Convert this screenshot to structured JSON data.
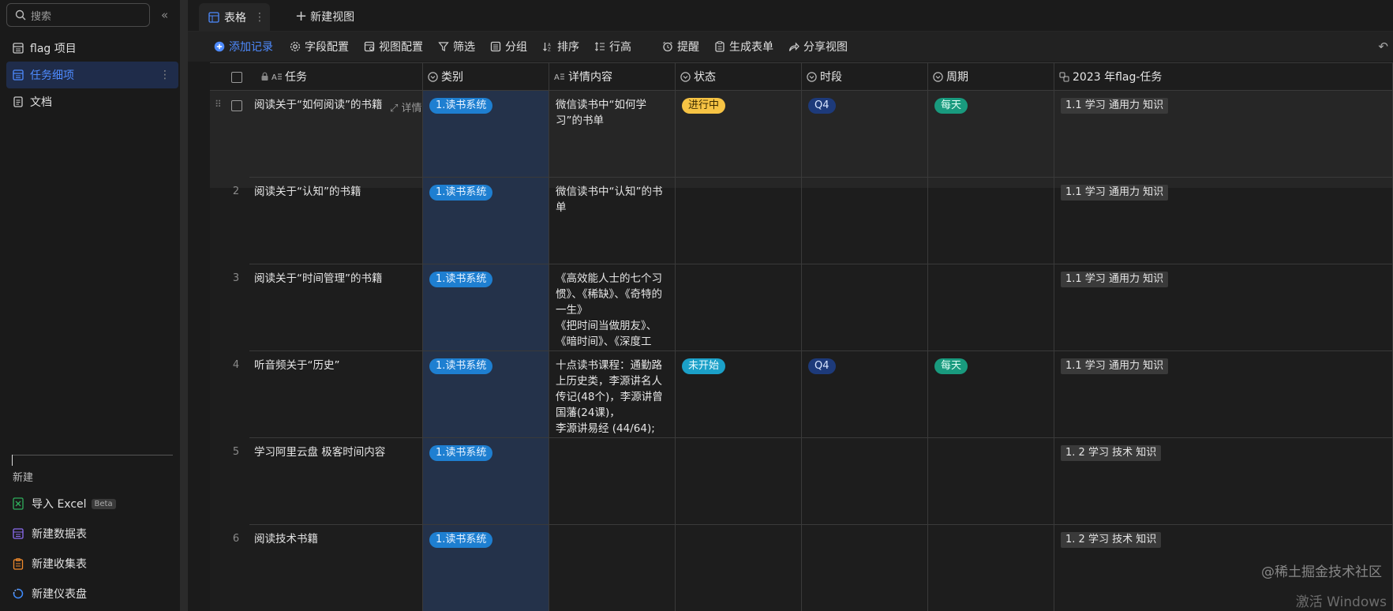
{
  "sidebar": {
    "search_placeholder": "搜索",
    "items": [
      {
        "label": "flag 项目"
      },
      {
        "label": "任务细项"
      },
      {
        "label": "文档"
      }
    ],
    "new_label": "新建",
    "create_items": [
      {
        "label": "导入 Excel",
        "badge": "Beta"
      },
      {
        "label": "新建数据表"
      },
      {
        "label": "新建收集表"
      },
      {
        "label": "新建仪表盘"
      }
    ]
  },
  "tabs": {
    "active": "表格",
    "new_view": "新建视图"
  },
  "toolbar": {
    "add": "添加记录",
    "field_config": "字段配置",
    "view_config": "视图配置",
    "filter": "筛选",
    "group": "分组",
    "sort": "排序",
    "row_height": "行高",
    "remind": "提醒",
    "form": "生成表单",
    "share": "分享视图"
  },
  "table": {
    "columns": [
      "任务",
      "类别",
      "详情内容",
      "状态",
      "时段",
      "周期",
      "2023 年flag-任务"
    ],
    "detail_link": "详情",
    "rows": [
      {
        "num": "",
        "task": "阅读关于“如何阅读”的书籍",
        "category": "1.读书系统",
        "detail": "微信读书中“如何学习”的书单",
        "status": "进行中",
        "period": "Q4",
        "cycle": "每天",
        "flag": "1.1 学习 通用力 知识"
      },
      {
        "num": "2",
        "task": "阅读关于“认知”的书籍",
        "category": "1.读书系统",
        "detail": "微信读书中“认知”的书单",
        "status": "",
        "period": "",
        "cycle": "",
        "flag": "1.1 学习 通用力 知识"
      },
      {
        "num": "3",
        "task": "阅读关于“时间管理”的书籍",
        "category": "1.读书系统",
        "detail": "《高效能人士的七个习惯》、《稀缺》、《奇特的一生》\n《把时间当做朋友》、《暗时间》、《深度工作》、《每天最重要的两小...",
        "status": "",
        "period": "",
        "cycle": "",
        "flag": "1.1 学习 通用力 知识"
      },
      {
        "num": "4",
        "task": "听音频关于“历史”",
        "category": "1.读书系统",
        "detail": "十点读书课程：通勤路上历史类，李源讲名人传记(48个)，李源讲曾国藩(24课)，\n李源讲易经 (44/64);",
        "status": "未开始",
        "period": "Q4",
        "cycle": "每天",
        "flag": "1.1 学习 通用力 知识"
      },
      {
        "num": "5",
        "task": "学习阿里云盘 极客时间内容",
        "category": "1.读书系统",
        "detail": "",
        "status": "",
        "period": "",
        "cycle": "",
        "flag": "1. 2 学习 技术 知识"
      },
      {
        "num": "6",
        "task": "阅读技术书籍",
        "category": "1.读书系统",
        "detail": "",
        "status": "",
        "period": "",
        "cycle": "",
        "flag": "1. 2 学习 技术 知识"
      }
    ]
  },
  "watermark": "@稀土掘金技术社区",
  "watermark2": "激活 Windows"
}
